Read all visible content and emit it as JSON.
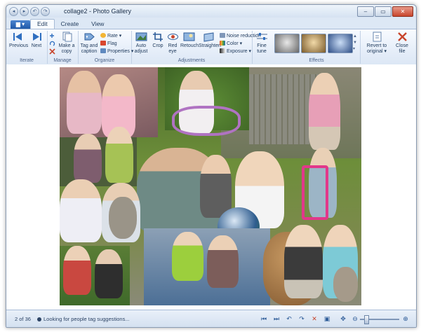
{
  "window": {
    "title": "collage2 - Photo Gallery",
    "controls": {
      "minimize": "–",
      "maximize": "▭",
      "close": "✕"
    }
  },
  "quick_access": [
    "◂",
    "▸",
    "↶",
    "↷"
  ],
  "tabs": {
    "app_menu": "▆ ▾",
    "items": [
      "Edit",
      "Create",
      "View"
    ],
    "active": "Edit"
  },
  "ribbon": {
    "iterate": {
      "label": "Iterate",
      "previous": "Previous",
      "next": "Next"
    },
    "manage": {
      "label": "Manage",
      "make_copy": "Make a copy"
    },
    "organize": {
      "label": "Organize",
      "tag_caption": "Tag and caption",
      "rate": "Rate",
      "flag": "Flag",
      "properties": "Properties"
    },
    "adjustments": {
      "label": "Adjustments",
      "auto_adjust": "Auto adjust",
      "crop": "Crop",
      "red_eye": "Red eye",
      "retouch": "Retouch",
      "straighten": "Straighten",
      "noise_reduction": "Noise reduction",
      "color": "Color",
      "exposure": "Exposure",
      "fine_tune": "Fine tune"
    },
    "effects": {
      "label": "Effects"
    },
    "revert": "Revert to original",
    "close_file": "Close file"
  },
  "status": {
    "count": "2 of 36",
    "message": "Looking for people tag suggestions..."
  },
  "colors": {
    "accent": "#1f58a8",
    "ribbon_bg": "#e6eef9",
    "close_red": "#c8452c"
  }
}
